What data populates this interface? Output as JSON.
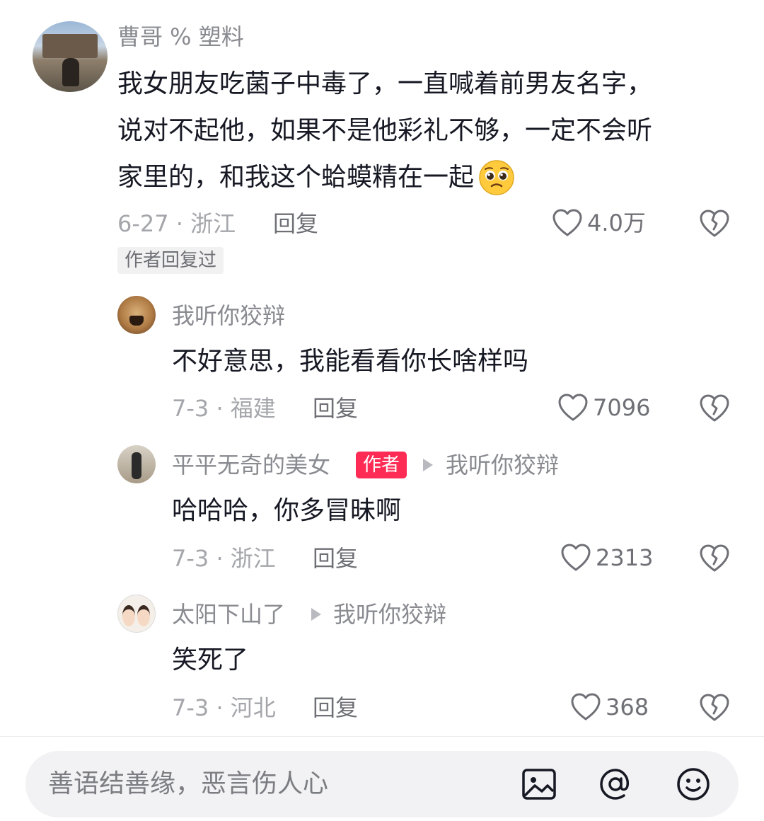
{
  "comments": [
    {
      "username": "曹哥 % 塑料",
      "text_lines": [
        "我女朋友吃菌子中毒了，一直喊着前男友名字，",
        "说对不起他，如果不是他彩礼不够，一定不会听",
        "家里的，和我这个蛤蟆精在一起"
      ],
      "emoji": "pleading-face",
      "date_location": "6-27 · 浙江",
      "reply_label": "回复",
      "likes": "4.0万",
      "author_replied_chip": "作者回复过"
    }
  ],
  "replies": [
    {
      "username": "我听你狡辩",
      "text": "不好意思，我能看看你长啥样吗",
      "date_location": "7-3 · 福建",
      "reply_label": "回复",
      "likes": "7096"
    },
    {
      "username": "平平无奇的美女",
      "author_badge": "作者",
      "reply_to": "我听你狡辩",
      "text": "哈哈哈，你多冒昧啊",
      "date_location": "7-3 · 浙江",
      "reply_label": "回复",
      "likes": "2313"
    },
    {
      "username": "太阳下山了",
      "reply_to": "我听你狡辩",
      "text": "笑死了",
      "date_location": "7-3 · 河北",
      "reply_label": "回复",
      "likes": "368"
    }
  ],
  "input_bar": {
    "placeholder": "善语结善缘，恶言伤人心",
    "icons": [
      "image-icon",
      "at-icon",
      "emoji-icon"
    ]
  },
  "colors": {
    "author_badge": "#fe2c55",
    "muted_text": "#a5a6ab",
    "username_text": "#8a8b91",
    "body_text": "#161823"
  }
}
